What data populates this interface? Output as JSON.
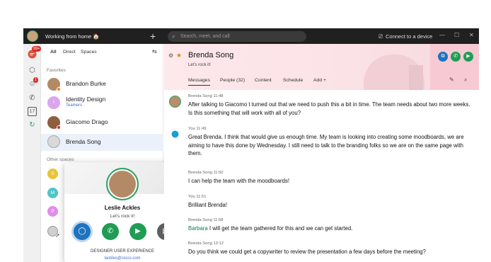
{
  "topbar": {
    "status": "Working from home 🏠",
    "plus": "+",
    "search_placeholder": "Search, meet, and call",
    "connect": "Connect to a device",
    "minimize": "—",
    "maximize": "☐",
    "close": "✕"
  },
  "rail": {
    "messaging_badge": "99+",
    "teams_badge": "1",
    "calendar_day": "17"
  },
  "list": {
    "tabs": [
      "All",
      "Direct",
      "Spaces"
    ],
    "section_favorites": "Favorites",
    "section_other": "Other spaces",
    "favorites": [
      {
        "name": "Brandon Burke"
      },
      {
        "name": "Identity Design",
        "sub": "Teamers",
        "initial": "I"
      },
      {
        "name": "Giacomo Drago"
      },
      {
        "name": "Brenda Song"
      }
    ],
    "other_initials": [
      "S",
      "M",
      "P"
    ]
  },
  "card": {
    "name": "Leslie Ackles",
    "status": "Let's rock it!",
    "title": "DESIGNER USER EXPERIENCE",
    "email": "lackles@cisco.com"
  },
  "space": {
    "title": "Brenda Song",
    "status": "Let's rock it!",
    "tabs": [
      "Messages",
      "People (32)",
      "Content",
      "Schedule",
      "Add +"
    ]
  },
  "messages": [
    {
      "meta": "Brenda Song   11:48",
      "text": "After talking to Giacomo t turned out that we need to push this a bit in time. The team needs about two more weeks. Is this something that will work with all of you?"
    },
    {
      "meta": "You   11:49",
      "text": "Great Brenda. I think that would give us enough time. My team is looking into creating some moodboards, we are aiming to have this done by Wednesday. I still need to talk to the branding folks so we are on the same page with them."
    },
    {
      "meta": "Brenda Song   11:50",
      "text": "I can help the team with the moodboards!"
    },
    {
      "meta": "You   11:51",
      "text": "Brilliant Brenda!"
    },
    {
      "meta": "Brenda Song   11:58",
      "who": "Barbara",
      "text": " I will get the team gathered for this and we can get started."
    },
    {
      "meta": "Brenda Song   13:12",
      "text": "Do you think we could get a copywriter to review the presentation a few days before the meeting?"
    }
  ],
  "colors": {
    "accent_green": "#1f9d55",
    "accent_blue": "#1e73be",
    "presence_green": "#3fb56a",
    "header_pink": "#fde8ec",
    "mention_teal": "#0a7a57"
  }
}
